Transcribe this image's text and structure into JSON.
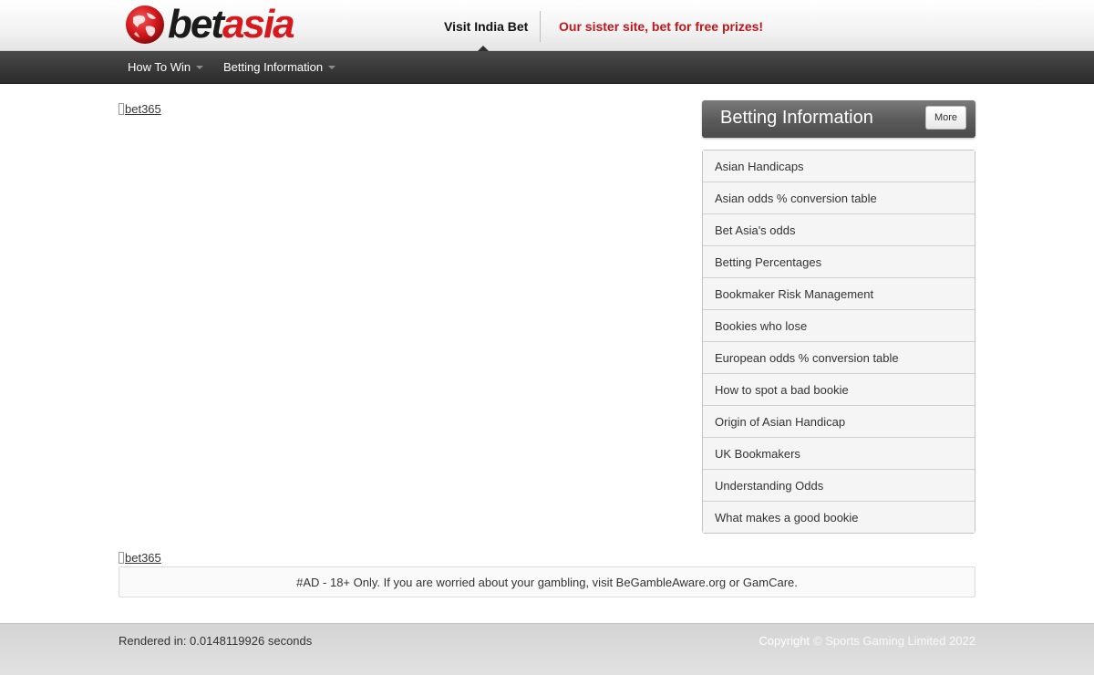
{
  "header": {
    "logo_bet": "bet",
    "logo_asia": "asia",
    "visit_link": "Visit India Bet",
    "sister_text": "Our sister site, bet for free prizes!"
  },
  "nav": {
    "items": [
      {
        "label": "How To Win"
      },
      {
        "label": "Betting Information"
      }
    ]
  },
  "main": {
    "banner_top_alt": "bet365",
    "banner_bottom_alt": "bet365",
    "ad_text": "#AD - 18+ Only. If you are worried about your gambling, visit BeGambleAware.org or GamCare."
  },
  "sidebar": {
    "title": "Betting Information",
    "more_label": "More",
    "items": [
      {
        "label": "Asian Handicaps"
      },
      {
        "label": "Asian odds % conversion table"
      },
      {
        "label": "Bet Asia's odds"
      },
      {
        "label": "Betting Percentages"
      },
      {
        "label": "Bookmaker Risk Management"
      },
      {
        "label": "Bookies who lose"
      },
      {
        "label": "European odds % conversion table"
      },
      {
        "label": "How to spot a bad bookie"
      },
      {
        "label": "Origin of Asian Handicap"
      },
      {
        "label": "UK Bookmakers"
      },
      {
        "label": "Understanding Odds"
      },
      {
        "label": "What makes a good bookie"
      }
    ]
  },
  "footer": {
    "rendered": "Rendered in: 0.0148119926 seconds",
    "copyright_word": "Copyright",
    "copyright_rest": "© Sports Gaming Limited 2022"
  },
  "colors": {
    "brand_red": "#d5191d",
    "nav_dark": "#2c2c2c"
  }
}
